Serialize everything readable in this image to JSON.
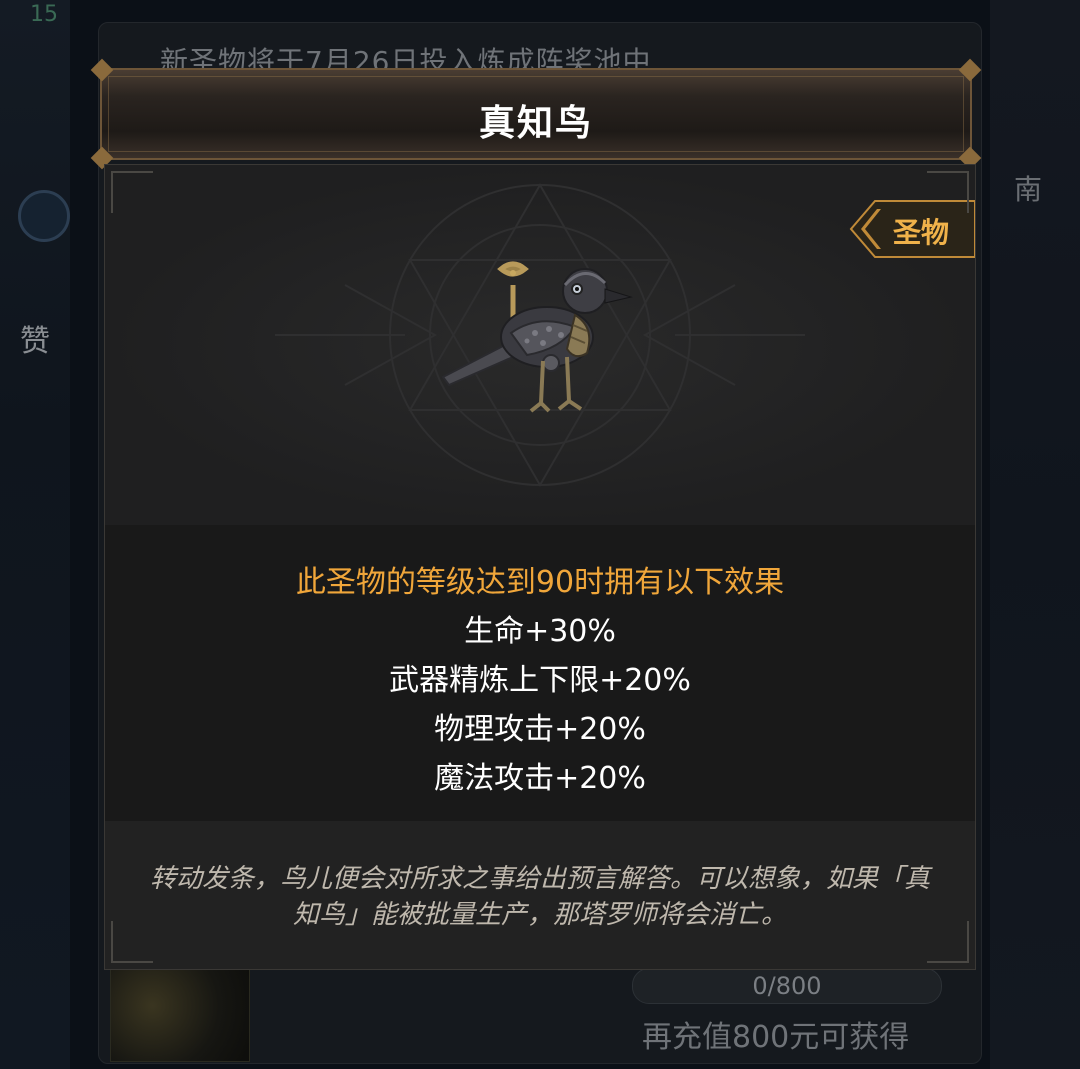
{
  "background": {
    "corner_number": "15",
    "notice_text": "新圣物将于7月26日投入炼成阵奖池中",
    "side_text": "赞",
    "right_text": "南",
    "progress": "0/800",
    "recharge_text": "再充值800元可获得"
  },
  "modal": {
    "title": "真知鸟",
    "tag": "圣物",
    "image_icon": "mechanical-bird-icon",
    "effects_heading": "此圣物的等级达到90时拥有以下效果",
    "effects": [
      "生命+30%",
      "武器精炼上下限+20%",
      "物理攻击+20%",
      "魔法攻击+20%"
    ],
    "description": "转动发条，鸟儿便会对所求之事给出预言解答。可以想象，如果「真知鸟」能被批量生产，那塔罗师将会消亡。"
  },
  "colors": {
    "accent_gold": "#f0a63a",
    "tag_gold": "#f0b24a",
    "header_border": "#6d5538"
  }
}
